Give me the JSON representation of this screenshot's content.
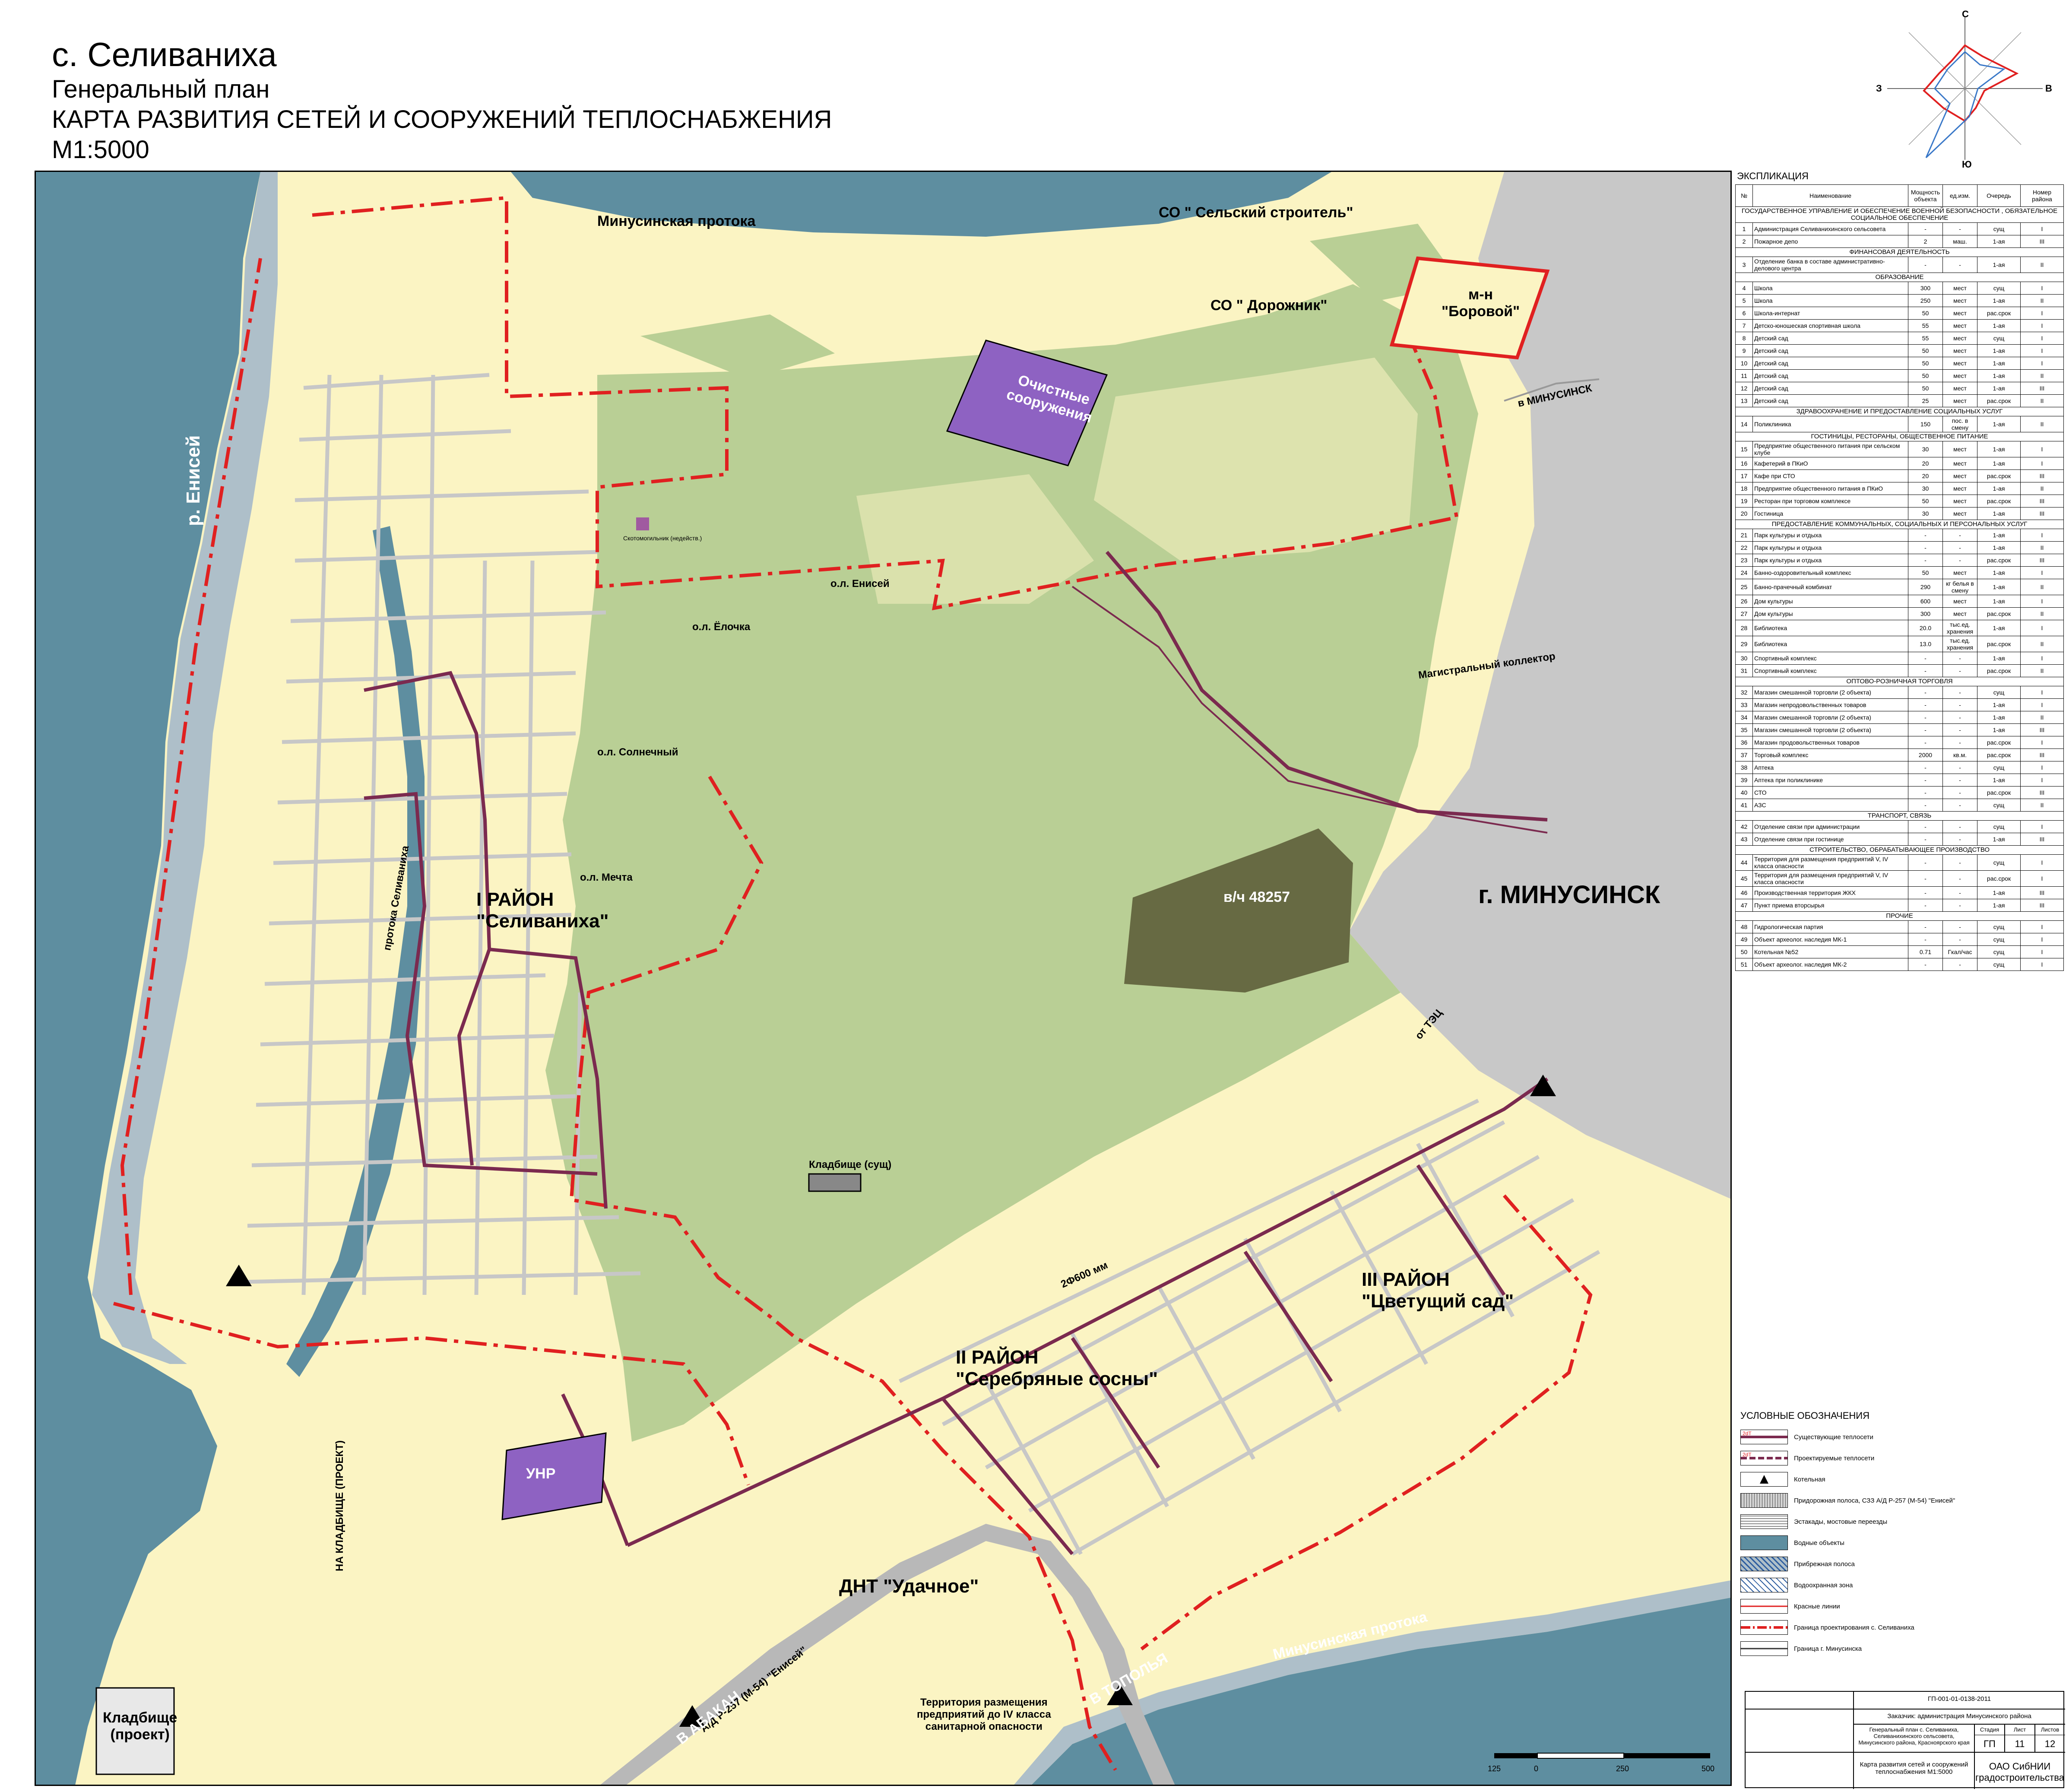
{
  "title": {
    "settlement": "с. Селиваниха",
    "line1": "Генеральный план",
    "line2": "КАРТА РАЗВИТИЯ СЕТЕЙ И СООРУЖЕНИЙ ТЕПЛОСНАБЖЕНИЯ",
    "scale": "М1:5000"
  },
  "compass": {
    "north": "С",
    "south": "Ю",
    "west": "З",
    "east": "В"
  },
  "colors": {
    "river": "#5e8ea0",
    "bank": "#aebfc9",
    "forest": "#b9cf95",
    "land": "#fbf4c3",
    "city": "#c8c8c8",
    "military": "#676a43",
    "facility": "#8e62c2",
    "pipe_existing": "#7b2a4f",
    "boundary": "#e02020",
    "street": "#c7c7c7"
  },
  "map_labels": {
    "river_yenisei": "р. Енисей",
    "protoka_top": "Минусинская протока",
    "protoka_bottom": "Минусинская протока",
    "protoka_selivanikha": "протока Селиваниха",
    "so_stroitel": "СО \" Сельский строитель\"",
    "so_dorozhnik": "СО \" Дорожник\"",
    "mn_borovoy_1": "м-н",
    "mn_borovoy_2": "\"Боровой\"",
    "ochistnye_1": "Очистные",
    "ochistnye_2": "сооружения",
    "to_minusinsk": "в МИНУСИНСК",
    "ol_enisei": "о.л. Енисей",
    "ol_elochka": "о.л. Ёлочка",
    "ol_solnechny": "о.л. Солнечный",
    "ol_mechta": "о.л. Мечта",
    "kollektor": "Магистральный коллектор",
    "vch": "в/ч 48257",
    "city_minusinsk": "г. МИНУСИНСК",
    "district1_1": "I РАЙОН",
    "district1_2": "\"Селиваниха\"",
    "district2_1": "II РАЙОН",
    "district2_2": "\"Серебряные сосны\"",
    "district3_1": "III РАЙОН",
    "district3_2": "\"Цветущий сад\"",
    "kladbishe_sush": "Кладбище (сущ)",
    "unr": "УНР",
    "na_kladbishe": "НА КЛАДБИЩЕ (ПРОЕКТ)",
    "dnt": "ДНТ \"Удачное\"",
    "ad_road": "А/Д Р-257 (М-54) \"Енисей\"",
    "v_abakan": "В АБАКАН",
    "v_topolya": "В ТОПОЛЬЯ",
    "kladbishe_proekt_1": "Кладбище",
    "kladbishe_proekt_2": "(проект)",
    "territory_1": "Территория размещения",
    "territory_2": "предприятий до IV класса",
    "territory_3": "санитарной опасности",
    "ot_tec": "от ТЭЦ",
    "pipe_len": "2Ф600 мм",
    "skotomogilnik": "Скотомогильник (недейств.)"
  },
  "explication": {
    "title": "ЭКСПЛИКАЦИЯ",
    "headers": [
      "№",
      "Наименование",
      "Мощность объекта",
      "ед.изм.",
      "Очередь",
      "Номер района"
    ],
    "sections": [
      {
        "title": "ГОСУДАРСТВЕННОЕ УПРАВЛЕНИЕ И ОБЕСПЕЧЕНИЕ ВОЕННОЙ БЕЗОПАСНОСТИ , ОБЯЗАТЕЛЬНОЕ СОЦИАЛЬНОЕ ОБЕСПЕЧЕНИЕ",
        "rows": [
          [
            "1",
            "Администрация Селиванихинского сельсовета",
            "-",
            "-",
            "сущ",
            "I"
          ],
          [
            "2",
            "Пожарное депо",
            "2",
            "маш.",
            "1-ая",
            "III"
          ]
        ]
      },
      {
        "title": "ФИНАНСОВАЯ ДЕЯТЕЛЬНОСТЬ",
        "rows": [
          [
            "3",
            "Отделение банка в составе административно-делового центра",
            "-",
            "-",
            "1-ая",
            "II"
          ]
        ]
      },
      {
        "title": "ОБРАЗОВАНИЕ",
        "rows": [
          [
            "4",
            "Школа",
            "300",
            "мест",
            "сущ",
            "I"
          ],
          [
            "5",
            "Школа",
            "250",
            "мест",
            "1-ая",
            "II"
          ],
          [
            "6",
            "Школа-интернат",
            "50",
            "мест",
            "рас.срок",
            "I"
          ],
          [
            "7",
            "Детско-юношеская спортивная школа",
            "55",
            "мест",
            "1-ая",
            "I"
          ],
          [
            "8",
            "Детский сад",
            "55",
            "мест",
            "сущ",
            "I"
          ],
          [
            "9",
            "Детский сад",
            "50",
            "мест",
            "1-ая",
            "I"
          ],
          [
            "10",
            "Детский сад",
            "50",
            "мест",
            "1-ая",
            "I"
          ],
          [
            "11",
            "Детский сад",
            "50",
            "мест",
            "1-ая",
            "II"
          ],
          [
            "12",
            "Детский сад",
            "50",
            "мест",
            "1-ая",
            "III"
          ],
          [
            "13",
            "Детский сад",
            "25",
            "мест",
            "рас.срок",
            "II"
          ]
        ]
      },
      {
        "title": "ЗДРАВООХРАНЕНИЕ И ПРЕДОСТАВЛЕНИЕ СОЦИАЛЬНЫХ УСЛУГ",
        "rows": [
          [
            "14",
            "Поликлиника",
            "150",
            "пос. в смену",
            "1-ая",
            "II"
          ]
        ]
      },
      {
        "title": "ГОСТИНИЦЫ, РЕСТОРАНЫ, ОБЩЕСТВЕННОЕ ПИТАНИЕ",
        "rows": [
          [
            "15",
            "Предприятие общественного питания при сельском клубе",
            "30",
            "мест",
            "1-ая",
            "I"
          ],
          [
            "16",
            "Кафетерий в ПКиО",
            "20",
            "мест",
            "1-ая",
            "I"
          ],
          [
            "17",
            "Кафе при СТО",
            "20",
            "мест",
            "рас.срок",
            "III"
          ],
          [
            "18",
            "Предприятие общественного питания в ПКиО",
            "30",
            "мест",
            "1-ая",
            "II"
          ],
          [
            "19",
            "Ресторан при торговом комплексе",
            "50",
            "мест",
            "рас.срок",
            "III"
          ],
          [
            "20",
            "Гостиница",
            "30",
            "мест",
            "1-ая",
            "III"
          ]
        ]
      },
      {
        "title": "ПРЕДОСТАВЛЕНИЕ КОММУНАЛЬНЫХ, СОЦИАЛЬНЫХ И ПЕРСОНАЛЬНЫХ УСЛУГ",
        "rows": [
          [
            "21",
            "Парк культуры и отдыха",
            "-",
            "-",
            "1-ая",
            "I"
          ],
          [
            "22",
            "Парк культуры и отдыха",
            "-",
            "-",
            "1-ая",
            "II"
          ],
          [
            "23",
            "Парк культуры и отдыха",
            "-",
            "-",
            "рас.срок",
            "III"
          ],
          [
            "24",
            "Банно-оздоровительный комплекс",
            "50",
            "мест",
            "1-ая",
            "I"
          ],
          [
            "25",
            "Банно-прачечный комбинат",
            "290",
            "кг белья в смену",
            "1-ая",
            "II"
          ],
          [
            "26",
            "Дом культуры",
            "600",
            "мест",
            "1-ая",
            "I"
          ],
          [
            "27",
            "Дом культуры",
            "300",
            "мест",
            "рас.срок",
            "II"
          ],
          [
            "28",
            "Библиотека",
            "20.0",
            "тыс.ед. хранения",
            "1-ая",
            "I"
          ],
          [
            "29",
            "Библиотека",
            "13.0",
            "тыс.ед. хранения",
            "рас.срок",
            "II"
          ],
          [
            "30",
            "Спортивный комплекс",
            "-",
            "-",
            "1-ая",
            "I"
          ],
          [
            "31",
            "Спортивный комплекс",
            "-",
            "-",
            "рас.срок",
            "II"
          ]
        ]
      },
      {
        "title": "ОПТОВО-РОЗНИЧНАЯ ТОРГОВЛЯ",
        "rows": [
          [
            "32",
            "Магазин смешанной торговли (2 объекта)",
            "-",
            "-",
            "сущ",
            "I"
          ],
          [
            "33",
            "Магазин непродовольственных товаров",
            "-",
            "-",
            "1-ая",
            "I"
          ],
          [
            "34",
            "Магазин смешанной торговли (2 объекта)",
            "-",
            "-",
            "1-ая",
            "II"
          ],
          [
            "35",
            "Магазин смешанной торговли (2 объекта)",
            "-",
            "-",
            "1-ая",
            "III"
          ],
          [
            "36",
            "Магазин продовольственных товаров",
            "-",
            "-",
            "рас.срок",
            "I"
          ],
          [
            "37",
            "Торговый комплекс",
            "2000",
            "кв.м.",
            "рас.срок",
            "III"
          ],
          [
            "38",
            "Аптека",
            "-",
            "-",
            "сущ",
            "I"
          ],
          [
            "39",
            "Аптека при поликлинике",
            "-",
            "-",
            "1-ая",
            "I"
          ],
          [
            "40",
            "СТО",
            "-",
            "-",
            "рас.срок",
            "III"
          ],
          [
            "41",
            "АЗС",
            "-",
            "-",
            "сущ",
            "II"
          ]
        ]
      },
      {
        "title": "ТРАНСПОРТ, СВЯЗЬ",
        "rows": [
          [
            "42",
            "Отделение связи при администрации",
            "-",
            "-",
            "сущ",
            "I"
          ],
          [
            "43",
            "Отделение связи при гостинице",
            "-",
            "-",
            "1-ая",
            "III"
          ]
        ]
      },
      {
        "title": "СТРОИТЕЛЬСТВО, ОБРАБАТЫВАЮЩЕЕ ПРОИЗВОДСТВО",
        "rows": [
          [
            "44",
            "Территория для размещения предприятий V, IV класса опасности",
            "-",
            "-",
            "сущ",
            "I"
          ],
          [
            "45",
            "Территория для размещения предприятий V, IV класса опасности",
            "-",
            "-",
            "рас.срок",
            "I"
          ],
          [
            "46",
            "Производственная территория ЖКХ",
            "-",
            "-",
            "1-ая",
            "III"
          ],
          [
            "47",
            "Пункт приема вторсырья",
            "-",
            "-",
            "1-ая",
            "III"
          ]
        ]
      },
      {
        "title": "ПРОЧИЕ",
        "rows": [
          [
            "48",
            "Гидрологическая партия",
            "-",
            "-",
            "сущ",
            "I"
          ],
          [
            "49",
            "Объект археолог. наследия МК-1",
            "-",
            "-",
            "сущ",
            "I"
          ],
          [
            "50",
            "Котельная №52",
            "0.71",
            "Гкал/час",
            "сущ",
            "I"
          ],
          [
            "51",
            "Объект археолог. наследия МК-2",
            "-",
            "-",
            "сущ",
            "I"
          ]
        ]
      }
    ]
  },
  "legend": {
    "title": "УСЛОВНЫЕ ОБОЗНАЧЕНИЯ",
    "items": [
      {
        "key": "existing-pipes",
        "label": "Существующие теплосети"
      },
      {
        "key": "projected-pipes",
        "label": "Проектируемые теплосети"
      },
      {
        "key": "boiler",
        "label": "Котельная"
      },
      {
        "key": "roadside",
        "label": "Придорожная полоса, СЗЗ А/Д Р-257 (М-54) \"Енисей\""
      },
      {
        "key": "overpass",
        "label": "Эстакады, мостовые переезды"
      },
      {
        "key": "water",
        "label": "Водные объекты"
      },
      {
        "key": "coastal",
        "label": "Прибрежная полоса"
      },
      {
        "key": "waterprotect",
        "label": "Водоохранная зона"
      },
      {
        "key": "redlines",
        "label": "Красные линии"
      },
      {
        "key": "design-border",
        "label": "Граница проектирования с. Селиваниха"
      },
      {
        "key": "city-border",
        "label": "Граница г. Минусинска"
      }
    ],
    "pipe_tag": "2dT"
  },
  "stamp": {
    "code": "ГП-001-01-0138-2011",
    "customer": "Заказчик: администрация Минусинского района",
    "project": "Генеральный план с. Селиваниха, Селиванихинского сельсовета, Минусинского района, Красноярского края",
    "stage_h": "Стадия",
    "sheet_h": "Лист",
    "sheets_h": "Листов",
    "stage": "ГП",
    "sheet": "11",
    "sheets": "12",
    "sheet_title": "Карта развития сетей и сооружений теплоснабжения М1:5000",
    "org": "ОАО СибНИИ градостроительства"
  },
  "scalebar": {
    "labels": [
      "125",
      "0",
      "250",
      "500"
    ]
  }
}
